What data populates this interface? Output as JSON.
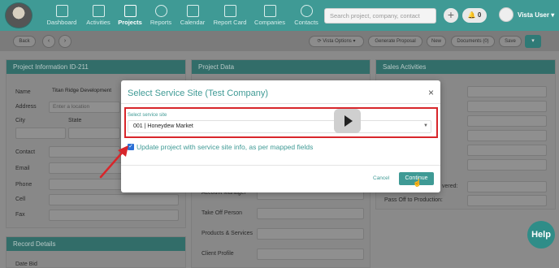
{
  "nav": {
    "items": [
      {
        "label": "Dashboard",
        "icon": "chart-icon"
      },
      {
        "label": "Activities",
        "icon": "list-icon"
      },
      {
        "label": "Projects",
        "icon": "folder-icon",
        "active": true
      },
      {
        "label": "Reports",
        "icon": "target-icon"
      },
      {
        "label": "Calendar",
        "icon": "calendar-icon"
      },
      {
        "label": "Report Card",
        "icon": "report-icon"
      },
      {
        "label": "Companies",
        "icon": "building-icon"
      },
      {
        "label": "Contacts",
        "icon": "person-icon"
      }
    ],
    "search_placeholder": "Search project, company, contact",
    "plus": "+",
    "notifications_count": "0",
    "user_name": "Vista User",
    "accent_color": "#3f9a95"
  },
  "toolbar": {
    "back": "Back",
    "prev": "‹",
    "next": "›",
    "vista_options": "Vista Options",
    "generate_proposal": "Generate Proposal",
    "new": "New",
    "documents": "Documents (0)",
    "save": "Save",
    "more": "▾"
  },
  "background": {
    "project_info_title": "Project Information ID-211",
    "name_label": "Name",
    "name_value": "Titan Ridge Development",
    "address_label": "Address",
    "address_placeholder": "Enter a location",
    "city_label": "City",
    "state_label": "State",
    "contact_label": "Contact",
    "email_label": "Email",
    "phone_label": "Phone",
    "cell_label": "Cell",
    "fax_label": "Fax",
    "record_details_title": "Record Details",
    "date_bid_label": "Date Bid",
    "project_data_title": "Project Data",
    "account_manager_label": "Account Manager",
    "take_off_label": "Take Off Person",
    "products_label": "Products & Services",
    "client_profile_label": "Client Profile",
    "sales_title": "Sales Activities",
    "delivered_label": "vered:",
    "pass_off_label": "Pass Off to Production:"
  },
  "modal": {
    "title": "Select Service Site (Test Company)",
    "close": "×",
    "select_label": "Select service site",
    "select_value": "001 | Honeydew Market",
    "checkbox_label": "Update project with service site info, as per mapped fields",
    "checkbox_checked": true,
    "cancel": "Cancel",
    "continue": "Continue",
    "highlight_color": "#d8262b"
  },
  "help": "Help"
}
